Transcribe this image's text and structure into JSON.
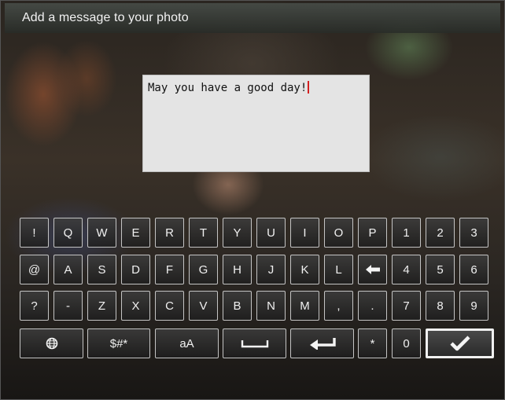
{
  "header": {
    "title": "Add a message to your photo"
  },
  "message": {
    "text": "May you have a good day!"
  },
  "keyboard": {
    "rows": [
      [
        {
          "label": "!",
          "name": "key-exclamation"
        },
        {
          "label": "Q",
          "name": "key-q"
        },
        {
          "label": "W",
          "name": "key-w"
        },
        {
          "label": "E",
          "name": "key-e"
        },
        {
          "label": "R",
          "name": "key-r"
        },
        {
          "label": "T",
          "name": "key-t"
        },
        {
          "label": "Y",
          "name": "key-y"
        },
        {
          "label": "U",
          "name": "key-u"
        },
        {
          "label": "I",
          "name": "key-i"
        },
        {
          "label": "O",
          "name": "key-o"
        },
        {
          "label": "P",
          "name": "key-p"
        },
        {
          "label": "1",
          "name": "key-1"
        },
        {
          "label": "2",
          "name": "key-2"
        },
        {
          "label": "3",
          "name": "key-3"
        }
      ],
      [
        {
          "label": "@",
          "name": "key-at"
        },
        {
          "label": "A",
          "name": "key-a"
        },
        {
          "label": "S",
          "name": "key-s"
        },
        {
          "label": "D",
          "name": "key-d"
        },
        {
          "label": "F",
          "name": "key-f"
        },
        {
          "label": "G",
          "name": "key-g"
        },
        {
          "label": "H",
          "name": "key-h"
        },
        {
          "label": "J",
          "name": "key-j"
        },
        {
          "label": "K",
          "name": "key-k"
        },
        {
          "label": "L",
          "name": "key-l"
        },
        {
          "icon": "backspace-arrow-icon",
          "name": "key-backspace"
        },
        {
          "label": "4",
          "name": "key-4"
        },
        {
          "label": "5",
          "name": "key-5"
        },
        {
          "label": "6",
          "name": "key-6"
        }
      ],
      [
        {
          "label": "?",
          "name": "key-question"
        },
        {
          "label": "-",
          "name": "key-hyphen"
        },
        {
          "label": "Z",
          "name": "key-z"
        },
        {
          "label": "X",
          "name": "key-x"
        },
        {
          "label": "C",
          "name": "key-c"
        },
        {
          "label": "V",
          "name": "key-v"
        },
        {
          "label": "B",
          "name": "key-b"
        },
        {
          "label": "N",
          "name": "key-n"
        },
        {
          "label": "M",
          "name": "key-m"
        },
        {
          "label": ",",
          "name": "key-comma"
        },
        {
          "label": ".",
          "name": "key-period"
        },
        {
          "label": "7",
          "name": "key-7"
        },
        {
          "label": "8",
          "name": "key-8"
        },
        {
          "label": "9",
          "name": "key-9"
        }
      ]
    ],
    "bottom_row": [
      {
        "icon": "globe-icon",
        "name": "key-language"
      },
      {
        "label": "$#*",
        "name": "key-symbols"
      },
      {
        "label": "aA",
        "name": "key-case-toggle"
      },
      {
        "icon": "space-bar-icon",
        "name": "key-space"
      },
      {
        "icon": "enter-arrow-icon",
        "name": "key-enter"
      },
      {
        "label": "*",
        "name": "key-asterisk"
      },
      {
        "label": "0",
        "name": "key-0"
      },
      {
        "icon": "checkmark-icon",
        "name": "key-confirm",
        "selected": true
      }
    ]
  },
  "colors": {
    "key_border": "#c4c4c4",
    "cursor": "#d42020",
    "message_bg": "#e4e4e4"
  }
}
